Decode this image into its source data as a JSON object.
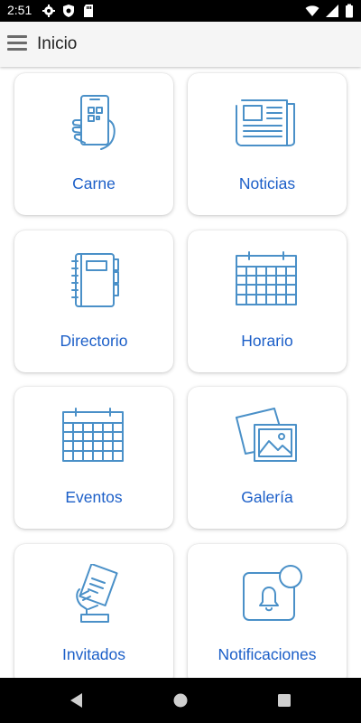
{
  "status_bar": {
    "time": "2:51",
    "left_icons": [
      "gear-icon",
      "shield-icon",
      "sd-card-icon"
    ],
    "right_icons": [
      "wifi-icon",
      "signal-icon",
      "battery-icon"
    ]
  },
  "app_bar": {
    "title": "Inicio",
    "menu_icon": "hamburger-menu-icon"
  },
  "tiles": [
    {
      "label": "Carne",
      "icon": "phone-qr-icon"
    },
    {
      "label": "Noticias",
      "icon": "newspaper-icon"
    },
    {
      "label": "Directorio",
      "icon": "notebook-icon"
    },
    {
      "label": "Horario",
      "icon": "calendar-icon"
    },
    {
      "label": "Eventos",
      "icon": "calendar-icon"
    },
    {
      "label": "Galería",
      "icon": "gallery-icon"
    },
    {
      "label": "Invitados",
      "icon": "invitation-hand-icon"
    },
    {
      "label": "Notificaciones",
      "icon": "notification-bell-icon"
    }
  ],
  "colors": {
    "accent_text": "#1c5fc8",
    "icon_stroke": "#4a90c8",
    "app_bar_bg": "#f5f5f5"
  },
  "nav_bar": {
    "buttons": [
      "back-icon",
      "home-icon",
      "recents-icon"
    ]
  }
}
